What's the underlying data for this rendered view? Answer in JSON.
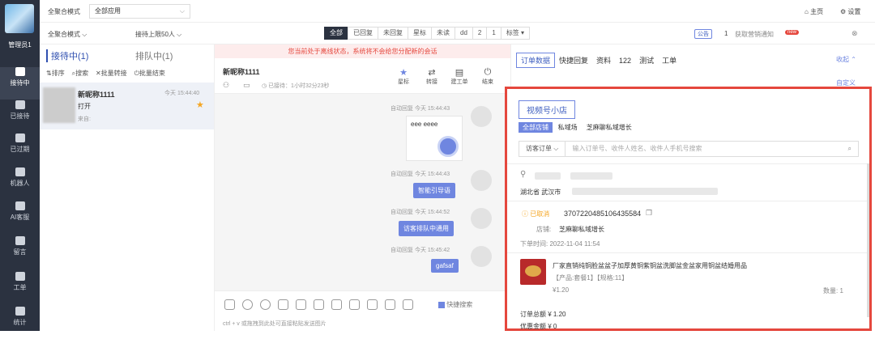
{
  "sidebar": {
    "user": "管理员1",
    "items": [
      "接待中",
      "已接待",
      "已过期",
      "机器人",
      "AI客服",
      "留言",
      "工单",
      "统计"
    ]
  },
  "topbar": {
    "mode_label": "全聚合模式",
    "app_select": "全部应用",
    "home": "主页",
    "settings": "设置"
  },
  "subbar": {
    "mode": "全聚合模式",
    "limit": "接待上限50人",
    "filters": [
      "全部",
      "已回复",
      "未回复",
      "星标",
      "未读",
      "dd",
      "2",
      "1",
      "标签"
    ],
    "notice_badge": "公告",
    "notice_count": "1",
    "notice_text": "获取营销通知",
    "new_badge": "new"
  },
  "list": {
    "tab_active": "接待中(1)",
    "tab_other": "排队中(1)",
    "actions": [
      "排序",
      "搜索",
      "批量转接",
      "批量结束"
    ],
    "item": {
      "name": "新昵称1111",
      "time": "今天 15:44:40",
      "msg": "打开",
      "from": "来自:"
    }
  },
  "chat": {
    "banner": "您当前处于离线状态，系统将不会给您分配新的会话",
    "name": "新昵称1111",
    "status": "已接待：1小时32分23秒",
    "actions": [
      "星标",
      "转接",
      "建工单",
      "结束"
    ],
    "messages": [
      {
        "meta": "自动回复  今天 15:44:43",
        "text": "eee eeee",
        "type": "card"
      },
      {
        "meta": "自动回复  今天 15:44:43",
        "text": "智能引导语"
      },
      {
        "meta": "自动回复  今天 15:44:52",
        "text": "访客排队中通用"
      },
      {
        "meta": "自动回复  今天 15:45:42",
        "text": "gafsaf"
      }
    ],
    "quick_search": "快捷搜索",
    "hint": "ctrl + v 或拖拽到此处可直接粘贴发送图片"
  },
  "right": {
    "tabs": [
      "订单数据",
      "快捷回复",
      "资料",
      "122",
      "测试",
      "工单"
    ],
    "collapse": "收起",
    "custom": "自定义",
    "shop_title": "视频号小店",
    "shop_tabs": [
      "全部店铺",
      "私域场",
      "芝麻聊私域增长"
    ],
    "search_select": "访客订单",
    "search_placeholder": "输入订单号、收件人姓名、收件人手机号搜索",
    "order": {
      "location": "湖北省 武汉市",
      "status": "已取消",
      "order_no": "3707220485106435584",
      "shop_label": "店铺:",
      "shop": "芝麻聊私域增长",
      "time": "下单时间: 2022-11-04 11:54",
      "product": "厂家直销纯铜脸盆盆子加厚黄铜紫铜盆洗脚盆金盆家用铜盆结婚用品",
      "spec": "【产品:套餐1】【规格:11】",
      "price": "¥1.20",
      "qty": "数量: 1",
      "total": "订单总额 ¥ 1.20",
      "discount": "优惠金额 ¥ 0"
    }
  }
}
